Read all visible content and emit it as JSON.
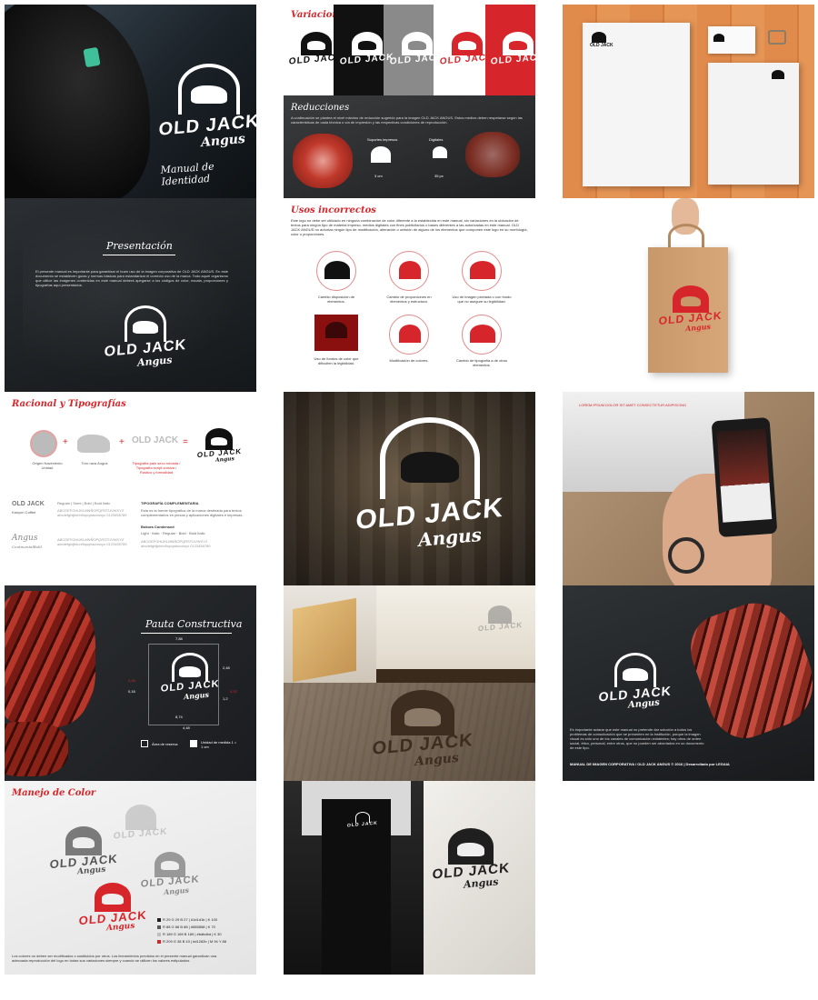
{
  "brand": {
    "name": "OLD JACK",
    "sub": "Angus"
  },
  "colors": {
    "red": "#d7262b",
    "black": "#111111",
    "gray": "#8a8a8a",
    "wood": "#d9844a",
    "kraft": "#c8976a"
  },
  "cover": {
    "title": "Manual de Identidad"
  },
  "presentation": {
    "heading": "Presentación",
    "body": "El presente manual es importante para garantizar el buen uso de la imagen corporativa de OLD JACK ANGUS. En este documento se establecen guías y normas básicas para estandarizar el correcto uso de la marca. Todo aquel organismo que utilice las imágenes contenidas en este manual deberá apegarse a los códigos de color, escala, proporciones y tipografías aquí presentados."
  },
  "variations": {
    "heading": "Variaciones"
  },
  "reductions": {
    "heading": "Reducciones",
    "body": "A continuación se plantea el nivel máximo de reducción sugerido para la imagen OLD JACK ANGUS. Estos medios deben respetarse según las características de cada técnica o vía de impresión y las respectivas condiciones de reproducción.",
    "print_label": "Soportes impresos",
    "digital_label": "Digitales",
    "print_size": "3 cm",
    "digital_size": "35 px"
  },
  "incorrect": {
    "heading": "Usos incorrectos",
    "body": "Este logo no debe ser utilizado en ninguna combinación de color diferente a la establecida en este manual, sin variaciones en la ubicación de textos para ningún tipo de material impreso, medios digitales con fines publicitarios o bases diferentes a las autorizadas en este manual. OLD JACK ANGUS no autoriza ningún tipo de modificación, alteración o omisión de alguno de los elementos que componen este logo en su morfología, color o proporciones.",
    "items": [
      "Cambio disposición de elementos.",
      "Cambio de proporciones en elementos y estructura.",
      "Uso de imagen pixelada o con fondo que no asegure su legibilidad.",
      "Uso de fondos de color que dificulten la legibilidad.",
      "Modificación de colores.",
      "Cambio de tipografía a de otros elementos."
    ]
  },
  "rationale": {
    "heading": "Racional y Tipografías",
    "items": [
      "Origen Nacimiento Unidad",
      "Toro raza Angus",
      "Tipografía palo seco robusta / Tipografía script cursiva / Rustico y formalidad"
    ],
    "font1": "Kanyon Coffee",
    "font1_sample": "Regular | Semi | Bold | Bold Italic",
    "font2": "ContinentalBold",
    "comp_heading": "TIPOGRAFÍA COMPLEMENTARIA",
    "comp_body": "Esta es la fuente tipográfica de la marca destinada para textos complementarios en piezas y aplicaciones digitales e impresas.",
    "comp_font": "Bokora Condensed",
    "comp_weights": "Light · Italic · Regular · Bold · Bold Italic"
  },
  "construction": {
    "heading": "Pauta Constructiva",
    "measures": [
      "7,88",
      "2,48",
      "0,28",
      "0,18",
      "1,2",
      "0,02",
      "8,74",
      "4,48"
    ],
    "legend": [
      "Área de reserva",
      "Unidad de medida 1 = 1 cm"
    ]
  },
  "color": {
    "heading": "Manejo de Color",
    "swatches": [
      "R 29 G 29 B 27 | #1d1d1b | K 100",
      "R 88 G 88 B 88 | #585858 | K 70",
      "R 189 G 189 B 189 | #bdbdbd | K 30",
      "R 209 G 38 B 43 | #d1262b | M 94 Y 88"
    ],
    "note": "Los colores no deben ser modificados o sustituidos por otros. Los lineamientos previstos en el presente manual garantizan una adecuada reproducción del logo en todas sus variaciones siempre y cuando se utilicen los valores estipulados."
  },
  "closing": {
    "body": "Es importante aclarar que este manual no pretende dar solución a todos los problemas de comunicación que se presenten en la institución, porque la imagen visual es sólo uno de los canales de comunicación existentes; hay otros de orden social, ético, personal, entre otros, que no pueden ser abordados en un documento de este tipo.",
    "footer": "MANUAL DE IMAGEN CORPORATIVA / OLD JACK ANGUS © 2016 | Desarrollado por LEGAIA"
  },
  "mobile": {
    "overlay": "LOREM IPSUM DOLOR SIT AMET CONSECTETUR ADIPISCING"
  }
}
